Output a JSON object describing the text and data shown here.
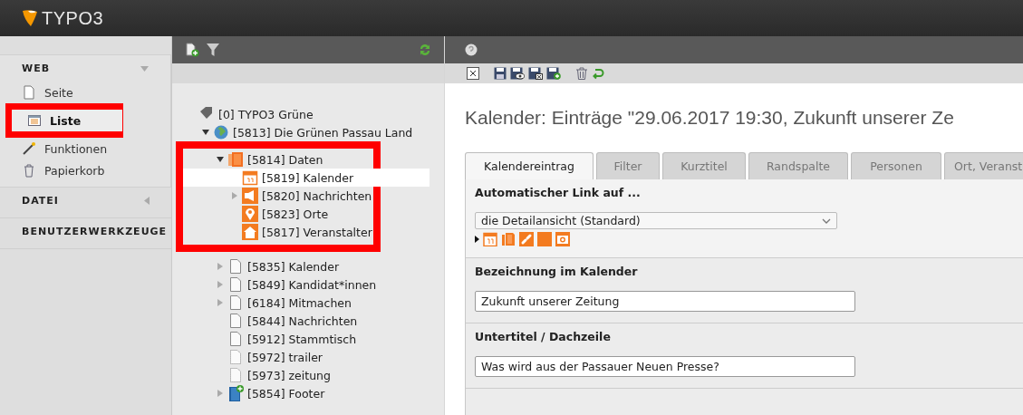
{
  "topbar": {
    "logo": "TYPO3"
  },
  "modules": [
    {
      "group": "WEB",
      "expanded": true,
      "items": [
        {
          "label": "Seite",
          "selected": false,
          "marked": false
        },
        {
          "label": "Liste",
          "selected": true,
          "marked": true
        },
        {
          "label": "Funktionen",
          "selected": false,
          "marked": false
        },
        {
          "label": "Papierkorb",
          "selected": false,
          "marked": false
        }
      ]
    },
    {
      "group": "DATEI",
      "expanded": false
    },
    {
      "group": "BENUTZERWERKZEUGE"
    }
  ],
  "tree": [
    {
      "label": "[0] TYPO3 Grüne",
      "kind": "root",
      "selected": false,
      "children": [
        {
          "label": "[5813] Die Grünen Passau Land",
          "kind": "site",
          "expanded": true,
          "selected": false,
          "children": [
            {
              "label": "[5814] Daten",
              "kind": "folder",
              "expanded": true,
              "selected": false,
              "marked": true,
              "children": [
                {
                  "label": "[5819] Kalender",
                  "kind": "calendar",
                  "selected": true
                },
                {
                  "label": "[5820] Nachrichten",
                  "kind": "news",
                  "expanded": false,
                  "selected": false
                },
                {
                  "label": "[5823] Orte",
                  "kind": "location",
                  "selected": false
                },
                {
                  "label": "[5817] Veranstalter",
                  "kind": "house",
                  "selected": false
                }
              ]
            },
            {
              "label": "[5835] Kalender",
              "kind": "page",
              "expanded": false,
              "selected": false,
              "marked": false
            },
            {
              "label": "[5849] Kandidat*innen",
              "kind": "page",
              "expanded": false,
              "selected": false,
              "marked": false
            },
            {
              "label": "[6184] Mitmachen",
              "kind": "page",
              "expanded": false,
              "selected": false,
              "marked": false
            },
            {
              "label": "[5844] Nachrichten",
              "kind": "page",
              "selected": false,
              "marked": false
            },
            {
              "label": "[5912] Stammtisch",
              "kind": "page",
              "selected": false,
              "marked": false
            },
            {
              "label": "[5972] trailer",
              "kind": "hidden",
              "selected": false,
              "marked": false
            },
            {
              "label": "[5973] zeitung",
              "kind": "hidden",
              "selected": false,
              "marked": false
            },
            {
              "label": "[5854] Footer",
              "kind": "book",
              "expanded": false,
              "selected": false,
              "marked": false
            }
          ]
        }
      ]
    }
  ],
  "editor": {
    "title": "Kalender: Einträge \"29.06.2017 19:30, Zukunft unserer Ze",
    "tabs": [
      {
        "label": "Kalendereintrag",
        "selected": true
      },
      {
        "label": "Filter",
        "selected": false
      },
      {
        "label": "Kurztitel",
        "selected": false
      },
      {
        "label": "Randspalte",
        "selected": false
      },
      {
        "label": "Personen",
        "selected": false
      },
      {
        "label": "Ort, Veranst",
        "selected": false
      }
    ],
    "fields": [
      {
        "kind": "select",
        "label": "Automatischer Link auf ...",
        "value": "die Detailansicht (Standard)"
      },
      {
        "kind": "text",
        "label": "Bezeichnung im Kalender",
        "value": "Zukunft unserer Zeitung"
      },
      {
        "kind": "text",
        "label": "Untertitel / Dachzeile",
        "value": "Was wird aus der Passauer Neuen Presse?"
      }
    ]
  }
}
